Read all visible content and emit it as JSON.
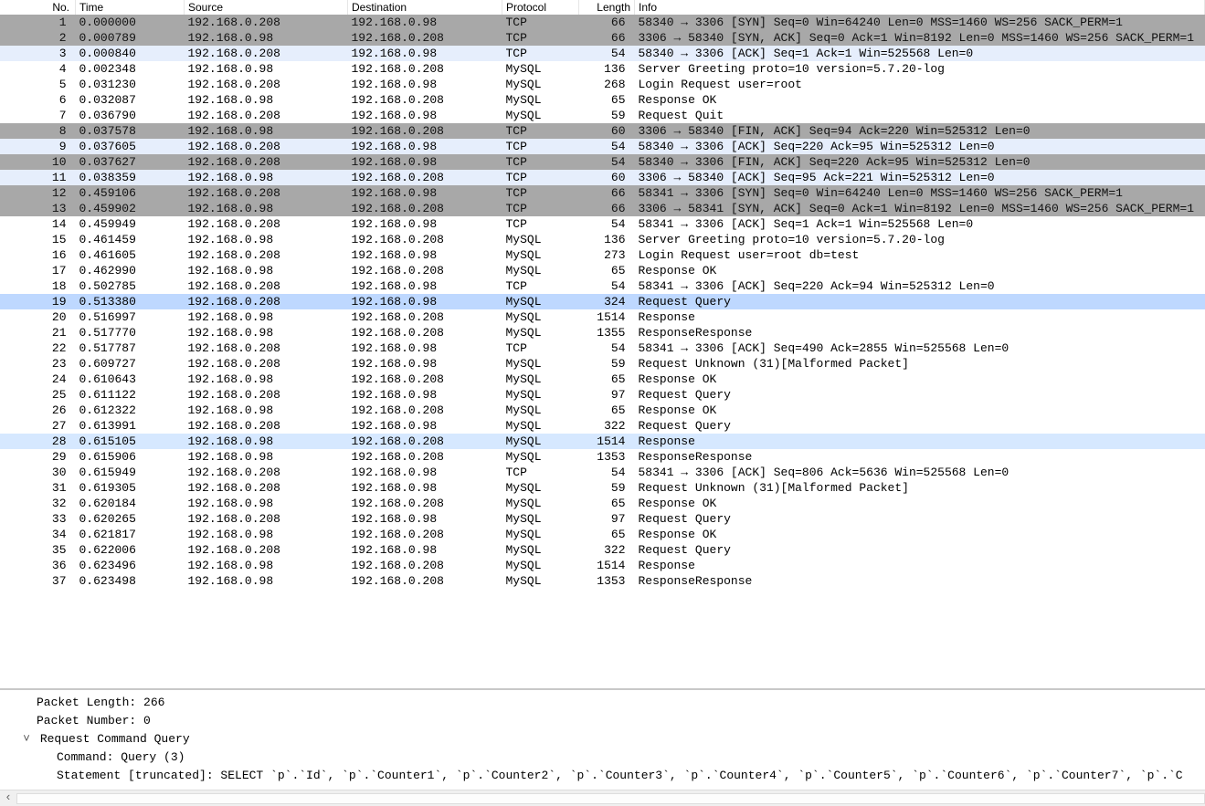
{
  "columns": {
    "no": "No.",
    "time": "Time",
    "source": "Source",
    "destination": "Destination",
    "protocol": "Protocol",
    "length": "Length",
    "info": "Info"
  },
  "rows": [
    {
      "no": 1,
      "time": "0.000000",
      "src": "192.168.0.208",
      "dst": "192.168.0.98",
      "proto": "TCP",
      "len": 66,
      "info": "58340 → 3306 [SYN] Seq=0 Win=64240 Len=0 MSS=1460 WS=256 SACK_PERM=1",
      "style": "syn"
    },
    {
      "no": 2,
      "time": "0.000789",
      "src": "192.168.0.98",
      "dst": "192.168.0.208",
      "proto": "TCP",
      "len": 66,
      "info": "3306 → 58340 [SYN, ACK] Seq=0 Ack=1 Win=8192 Len=0 MSS=1460 WS=256 SACK_PERM=1",
      "style": "syn"
    },
    {
      "no": 3,
      "time": "0.000840",
      "src": "192.168.0.208",
      "dst": "192.168.0.98",
      "proto": "TCP",
      "len": 54,
      "info": "58340 → 3306 [ACK] Seq=1 Ack=1 Win=525568 Len=0",
      "style": "light"
    },
    {
      "no": 4,
      "time": "0.002348",
      "src": "192.168.0.98",
      "dst": "192.168.0.208",
      "proto": "MySQL",
      "len": 136,
      "info": "Server Greeting proto=10 version=5.7.20-log",
      "style": "white"
    },
    {
      "no": 5,
      "time": "0.031230",
      "src": "192.168.0.208",
      "dst": "192.168.0.98",
      "proto": "MySQL",
      "len": 268,
      "info": "Login Request user=root",
      "style": "white"
    },
    {
      "no": 6,
      "time": "0.032087",
      "src": "192.168.0.98",
      "dst": "192.168.0.208",
      "proto": "MySQL",
      "len": 65,
      "info": "Response OK",
      "style": "white"
    },
    {
      "no": 7,
      "time": "0.036790",
      "src": "192.168.0.208",
      "dst": "192.168.0.98",
      "proto": "MySQL",
      "len": 59,
      "info": "Request Quit",
      "style": "white"
    },
    {
      "no": 8,
      "time": "0.037578",
      "src": "192.168.0.98",
      "dst": "192.168.0.208",
      "proto": "TCP",
      "len": 60,
      "info": "3306 → 58340 [FIN, ACK] Seq=94 Ack=220 Win=525312 Len=0",
      "style": "syn"
    },
    {
      "no": 9,
      "time": "0.037605",
      "src": "192.168.0.208",
      "dst": "192.168.0.98",
      "proto": "TCP",
      "len": 54,
      "info": "58340 → 3306 [ACK] Seq=220 Ack=95 Win=525312 Len=0",
      "style": "light"
    },
    {
      "no": 10,
      "time": "0.037627",
      "src": "192.168.0.208",
      "dst": "192.168.0.98",
      "proto": "TCP",
      "len": 54,
      "info": "58340 → 3306 [FIN, ACK] Seq=220 Ack=95 Win=525312 Len=0",
      "style": "syn"
    },
    {
      "no": 11,
      "time": "0.038359",
      "src": "192.168.0.98",
      "dst": "192.168.0.208",
      "proto": "TCP",
      "len": 60,
      "info": "3306 → 58340 [ACK] Seq=95 Ack=221 Win=525312 Len=0",
      "style": "light"
    },
    {
      "no": 12,
      "time": "0.459106",
      "src": "192.168.0.208",
      "dst": "192.168.0.98",
      "proto": "TCP",
      "len": 66,
      "info": "58341 → 3306 [SYN] Seq=0 Win=64240 Len=0 MSS=1460 WS=256 SACK_PERM=1",
      "style": "syn"
    },
    {
      "no": 13,
      "time": "0.459902",
      "src": "192.168.0.98",
      "dst": "192.168.0.208",
      "proto": "TCP",
      "len": 66,
      "info": "3306 → 58341 [SYN, ACK] Seq=0 Ack=1 Win=8192 Len=0 MSS=1460 WS=256 SACK_PERM=1",
      "style": "syn"
    },
    {
      "no": 14,
      "time": "0.459949",
      "src": "192.168.0.208",
      "dst": "192.168.0.98",
      "proto": "TCP",
      "len": 54,
      "info": "58341 → 3306 [ACK] Seq=1 Ack=1 Win=525568 Len=0",
      "style": "white"
    },
    {
      "no": 15,
      "time": "0.461459",
      "src": "192.168.0.98",
      "dst": "192.168.0.208",
      "proto": "MySQL",
      "len": 136,
      "info": "Server Greeting proto=10 version=5.7.20-log",
      "style": "white"
    },
    {
      "no": 16,
      "time": "0.461605",
      "src": "192.168.0.208",
      "dst": "192.168.0.98",
      "proto": "MySQL",
      "len": 273,
      "info": "Login Request user=root db=test",
      "style": "white"
    },
    {
      "no": 17,
      "time": "0.462990",
      "src": "192.168.0.98",
      "dst": "192.168.0.208",
      "proto": "MySQL",
      "len": 65,
      "info": "Response OK",
      "style": "white"
    },
    {
      "no": 18,
      "time": "0.502785",
      "src": "192.168.0.208",
      "dst": "192.168.0.98",
      "proto": "TCP",
      "len": 54,
      "info": "58341 → 3306 [ACK] Seq=220 Ack=94 Win=525312 Len=0",
      "style": "white"
    },
    {
      "no": 19,
      "time": "0.513380",
      "src": "192.168.0.208",
      "dst": "192.168.0.98",
      "proto": "MySQL",
      "len": 324,
      "info": "Request Query",
      "style": "sel"
    },
    {
      "no": 20,
      "time": "0.516997",
      "src": "192.168.0.98",
      "dst": "192.168.0.208",
      "proto": "MySQL",
      "len": 1514,
      "info": "Response",
      "style": "white"
    },
    {
      "no": 21,
      "time": "0.517770",
      "src": "192.168.0.98",
      "dst": "192.168.0.208",
      "proto": "MySQL",
      "len": 1355,
      "info": "ResponseResponse",
      "style": "white"
    },
    {
      "no": 22,
      "time": "0.517787",
      "src": "192.168.0.208",
      "dst": "192.168.0.98",
      "proto": "TCP",
      "len": 54,
      "info": "58341 → 3306 [ACK] Seq=490 Ack=2855 Win=525568 Len=0",
      "style": "white"
    },
    {
      "no": 23,
      "time": "0.609727",
      "src": "192.168.0.208",
      "dst": "192.168.0.98",
      "proto": "MySQL",
      "len": 59,
      "info": "Request Unknown (31)[Malformed Packet]",
      "style": "white"
    },
    {
      "no": 24,
      "time": "0.610643",
      "src": "192.168.0.98",
      "dst": "192.168.0.208",
      "proto": "MySQL",
      "len": 65,
      "info": "Response OK",
      "style": "white"
    },
    {
      "no": 25,
      "time": "0.611122",
      "src": "192.168.0.208",
      "dst": "192.168.0.98",
      "proto": "MySQL",
      "len": 97,
      "info": "Request Query",
      "style": "white"
    },
    {
      "no": 26,
      "time": "0.612322",
      "src": "192.168.0.98",
      "dst": "192.168.0.208",
      "proto": "MySQL",
      "len": 65,
      "info": "Response OK",
      "style": "white"
    },
    {
      "no": 27,
      "time": "0.613991",
      "src": "192.168.0.208",
      "dst": "192.168.0.98",
      "proto": "MySQL",
      "len": 322,
      "info": "Request Query",
      "style": "white"
    },
    {
      "no": 28,
      "time": "0.615105",
      "src": "192.168.0.98",
      "dst": "192.168.0.208",
      "proto": "MySQL",
      "len": 1514,
      "info": "Response",
      "style": "sel2"
    },
    {
      "no": 29,
      "time": "0.615906",
      "src": "192.168.0.98",
      "dst": "192.168.0.208",
      "proto": "MySQL",
      "len": 1353,
      "info": "ResponseResponse",
      "style": "white"
    },
    {
      "no": 30,
      "time": "0.615949",
      "src": "192.168.0.208",
      "dst": "192.168.0.98",
      "proto": "TCP",
      "len": 54,
      "info": "58341 → 3306 [ACK] Seq=806 Ack=5636 Win=525568 Len=0",
      "style": "white"
    },
    {
      "no": 31,
      "time": "0.619305",
      "src": "192.168.0.208",
      "dst": "192.168.0.98",
      "proto": "MySQL",
      "len": 59,
      "info": "Request Unknown (31)[Malformed Packet]",
      "style": "white"
    },
    {
      "no": 32,
      "time": "0.620184",
      "src": "192.168.0.98",
      "dst": "192.168.0.208",
      "proto": "MySQL",
      "len": 65,
      "info": "Response OK",
      "style": "white"
    },
    {
      "no": 33,
      "time": "0.620265",
      "src": "192.168.0.208",
      "dst": "192.168.0.98",
      "proto": "MySQL",
      "len": 97,
      "info": "Request Query",
      "style": "white"
    },
    {
      "no": 34,
      "time": "0.621817",
      "src": "192.168.0.98",
      "dst": "192.168.0.208",
      "proto": "MySQL",
      "len": 65,
      "info": "Response OK",
      "style": "white"
    },
    {
      "no": 35,
      "time": "0.622006",
      "src": "192.168.0.208",
      "dst": "192.168.0.98",
      "proto": "MySQL",
      "len": 322,
      "info": "Request Query",
      "style": "white"
    },
    {
      "no": 36,
      "time": "0.623496",
      "src": "192.168.0.98",
      "dst": "192.168.0.208",
      "proto": "MySQL",
      "len": 1514,
      "info": "Response",
      "style": "white"
    },
    {
      "no": 37,
      "time": "0.623498",
      "src": "192.168.0.98",
      "dst": "192.168.0.208",
      "proto": "MySQL",
      "len": 1353,
      "info": "ResponseResponse",
      "style": "white"
    }
  ],
  "details": {
    "packet_length": "Packet Length: 266",
    "packet_number": "Packet Number: 0",
    "request_command": "Request Command Query",
    "command": "Command: Query (3)",
    "statement": "Statement [truncated]: SELECT `p`.`Id`, `p`.`Counter1`, `p`.`Counter2`, `p`.`Counter3`, `p`.`Counter4`, `p`.`Counter5`, `p`.`Counter6`, `p`.`Counter7`, `p`.`C"
  },
  "scroll_left_glyph": "‹"
}
